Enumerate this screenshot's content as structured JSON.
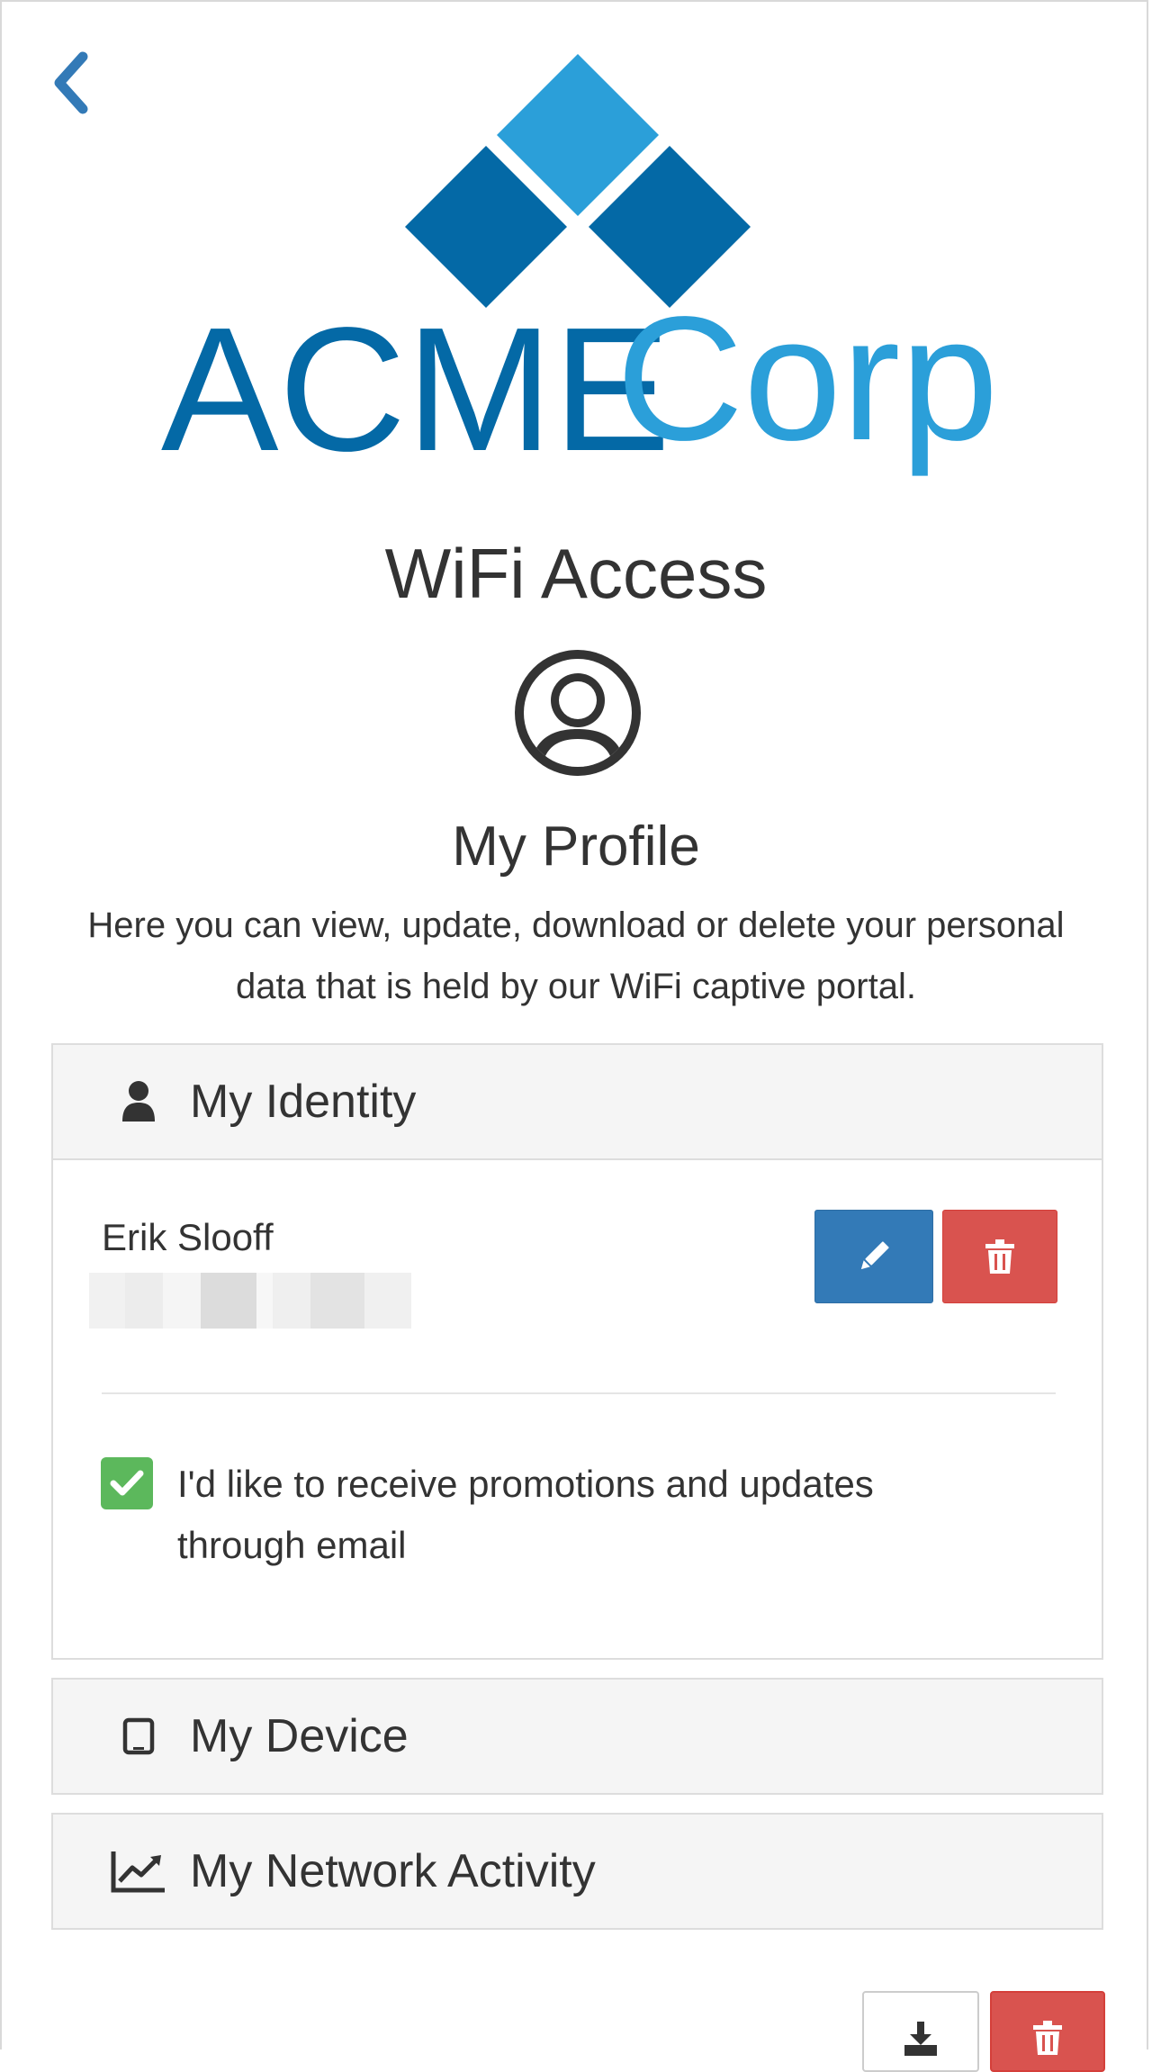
{
  "header": {
    "back_icon": "chevron-left-icon",
    "logo": {
      "word1": "ACME",
      "word2": "Corp",
      "color_dark": "#0469a6",
      "color_light": "#2b9fd9"
    }
  },
  "page": {
    "title": "WiFi Access",
    "avatar_icon": "user-circle-icon",
    "subtitle": "My Profile",
    "description": "Here you can view, update, download or delete your personal data that is held by our WiFi captive portal."
  },
  "identity_panel": {
    "icon": "user-icon",
    "label": "My Identity",
    "name": "Erik Slooff",
    "edit_icon": "pencil-icon",
    "delete_icon": "trash-icon",
    "promo_checked": true,
    "promo_label": "I'd like to receive promotions and updates through email"
  },
  "device_panel": {
    "icon": "tablet-icon",
    "label": "My Device"
  },
  "network_panel": {
    "icon": "line-chart-icon",
    "label": "My Network Activity"
  },
  "footer": {
    "download_icon": "download-icon",
    "delete_icon": "trash-icon"
  },
  "colors": {
    "primary": "#337ab7",
    "danger": "#d9534f",
    "success": "#5cb85c",
    "panel_heading": "#f5f5f5"
  }
}
